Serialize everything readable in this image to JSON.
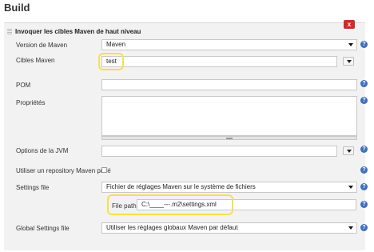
{
  "section": {
    "title": "Build"
  },
  "step": {
    "title": "Invoquer les cibles Maven de haut niveau",
    "close_label": "x"
  },
  "fields": {
    "maven_version": {
      "label": "Version de Maven",
      "value": "Maven"
    },
    "goals": {
      "label": "Cibles Maven",
      "value": "test"
    },
    "pom": {
      "label": "POM",
      "value": ""
    },
    "properties": {
      "label": "Propriétés",
      "value": ""
    },
    "jvm_options": {
      "label": "Options de la JVM",
      "value": ""
    },
    "private_repo": {
      "label": "Utiliser un repository Maven privé",
      "checked": false
    },
    "settings_file": {
      "label": "Settings file",
      "value": "Fichier de réglages Maven sur le système de fichiers"
    },
    "file_path": {
      "label": "File path",
      "value": "C:\\____---.m2\\settings.xml"
    },
    "global_settings": {
      "label": "Global Settings file",
      "value": "Utiliser les réglages globaux Maven par défaut"
    }
  },
  "help_label": "?",
  "colors": {
    "help": "#3e6fbd",
    "close": "#c9302c",
    "highlight": "#f5e04c",
    "panel": "#f2f2f2"
  }
}
